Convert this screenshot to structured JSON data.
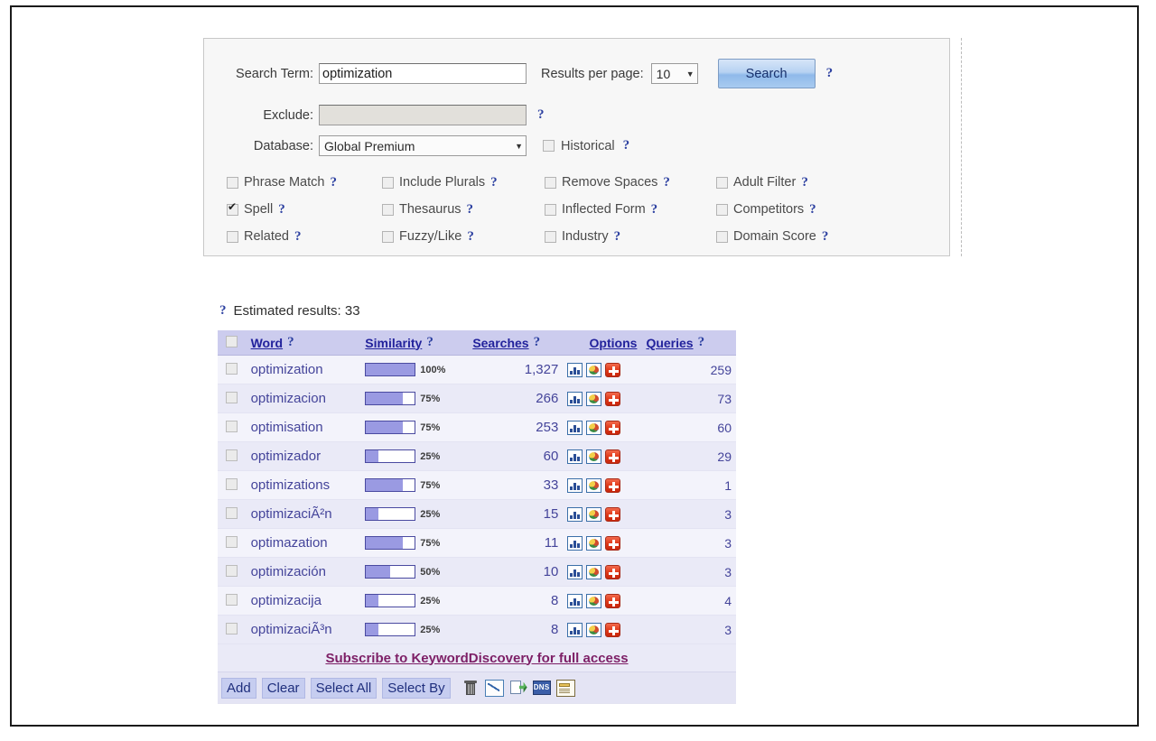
{
  "form": {
    "search_term_label": "Search Term:",
    "search_term_value": "optimization",
    "results_per_page_label": "Results per page:",
    "results_per_page_value": "10",
    "exclude_label": "Exclude:",
    "exclude_value": "",
    "exclude_placeholder": "",
    "database_label": "Database:",
    "database_value": "Global Premium",
    "historical_label": "Historical",
    "historical_checked": false,
    "search_button": "Search",
    "help_glyph": "?"
  },
  "options": [
    {
      "label": "Phrase Match",
      "checked": false
    },
    {
      "label": "Include Plurals",
      "checked": false
    },
    {
      "label": "Remove Spaces",
      "checked": false
    },
    {
      "label": "Adult Filter",
      "checked": false
    },
    {
      "label": "Spell",
      "checked": true
    },
    {
      "label": "Thesaurus",
      "checked": false
    },
    {
      "label": "Inflected Form",
      "checked": false
    },
    {
      "label": "Competitors",
      "checked": false
    },
    {
      "label": "Related",
      "checked": false
    },
    {
      "label": "Fuzzy/Like",
      "checked": false
    },
    {
      "label": "Industry",
      "checked": false
    },
    {
      "label": "Domain Score",
      "checked": false
    }
  ],
  "results": {
    "estimated_label": "Estimated results: 33",
    "columns": {
      "word": "Word",
      "similarity": "Similarity",
      "searches": "Searches",
      "options": "Options",
      "queries": "Queries"
    },
    "rows": [
      {
        "word": "optimization",
        "similarity": 100,
        "similarity_label": "100%",
        "searches": "1,327",
        "queries": "259"
      },
      {
        "word": "optimizacion",
        "similarity": 75,
        "similarity_label": "75%",
        "searches": "266",
        "queries": "73"
      },
      {
        "word": "optimisation",
        "similarity": 75,
        "similarity_label": "75%",
        "searches": "253",
        "queries": "60"
      },
      {
        "word": "optimizador",
        "similarity": 25,
        "similarity_label": "25%",
        "searches": "60",
        "queries": "29"
      },
      {
        "word": "optimizations",
        "similarity": 75,
        "similarity_label": "75%",
        "searches": "33",
        "queries": "1"
      },
      {
        "word": "optimizaciÃ²n",
        "similarity": 25,
        "similarity_label": "25%",
        "searches": "15",
        "queries": "3"
      },
      {
        "word": "optimazation",
        "similarity": 75,
        "similarity_label": "75%",
        "searches": "11",
        "queries": "3"
      },
      {
        "word": "optimización",
        "similarity": 50,
        "similarity_label": "50%",
        "searches": "10",
        "queries": "3"
      },
      {
        "word": "optimizacija",
        "similarity": 25,
        "similarity_label": "25%",
        "searches": "8",
        "queries": "4"
      },
      {
        "word": "optimizaciÃ³n",
        "similarity": 25,
        "similarity_label": "25%",
        "searches": "8",
        "queries": "3"
      }
    ],
    "row_option_icons": [
      "bar-chart-icon",
      "globe-icon",
      "add-plus-icon"
    ],
    "subscribe_link": "Subscribe to KeywordDiscovery for full access"
  },
  "footer": {
    "buttons": [
      "Add",
      "Clear",
      "Select All",
      "Select By"
    ],
    "icons": [
      "trash-icon",
      "graph-icon",
      "export-icon",
      "dns-icon",
      "report-icon"
    ],
    "dns_label": "DNS"
  },
  "colors": {
    "link": "#22229c",
    "accent": "#ccccee",
    "subscribe": "#7d1f66",
    "bar_fill": "#9a9ae2",
    "plus_red": "#e03a1a"
  }
}
